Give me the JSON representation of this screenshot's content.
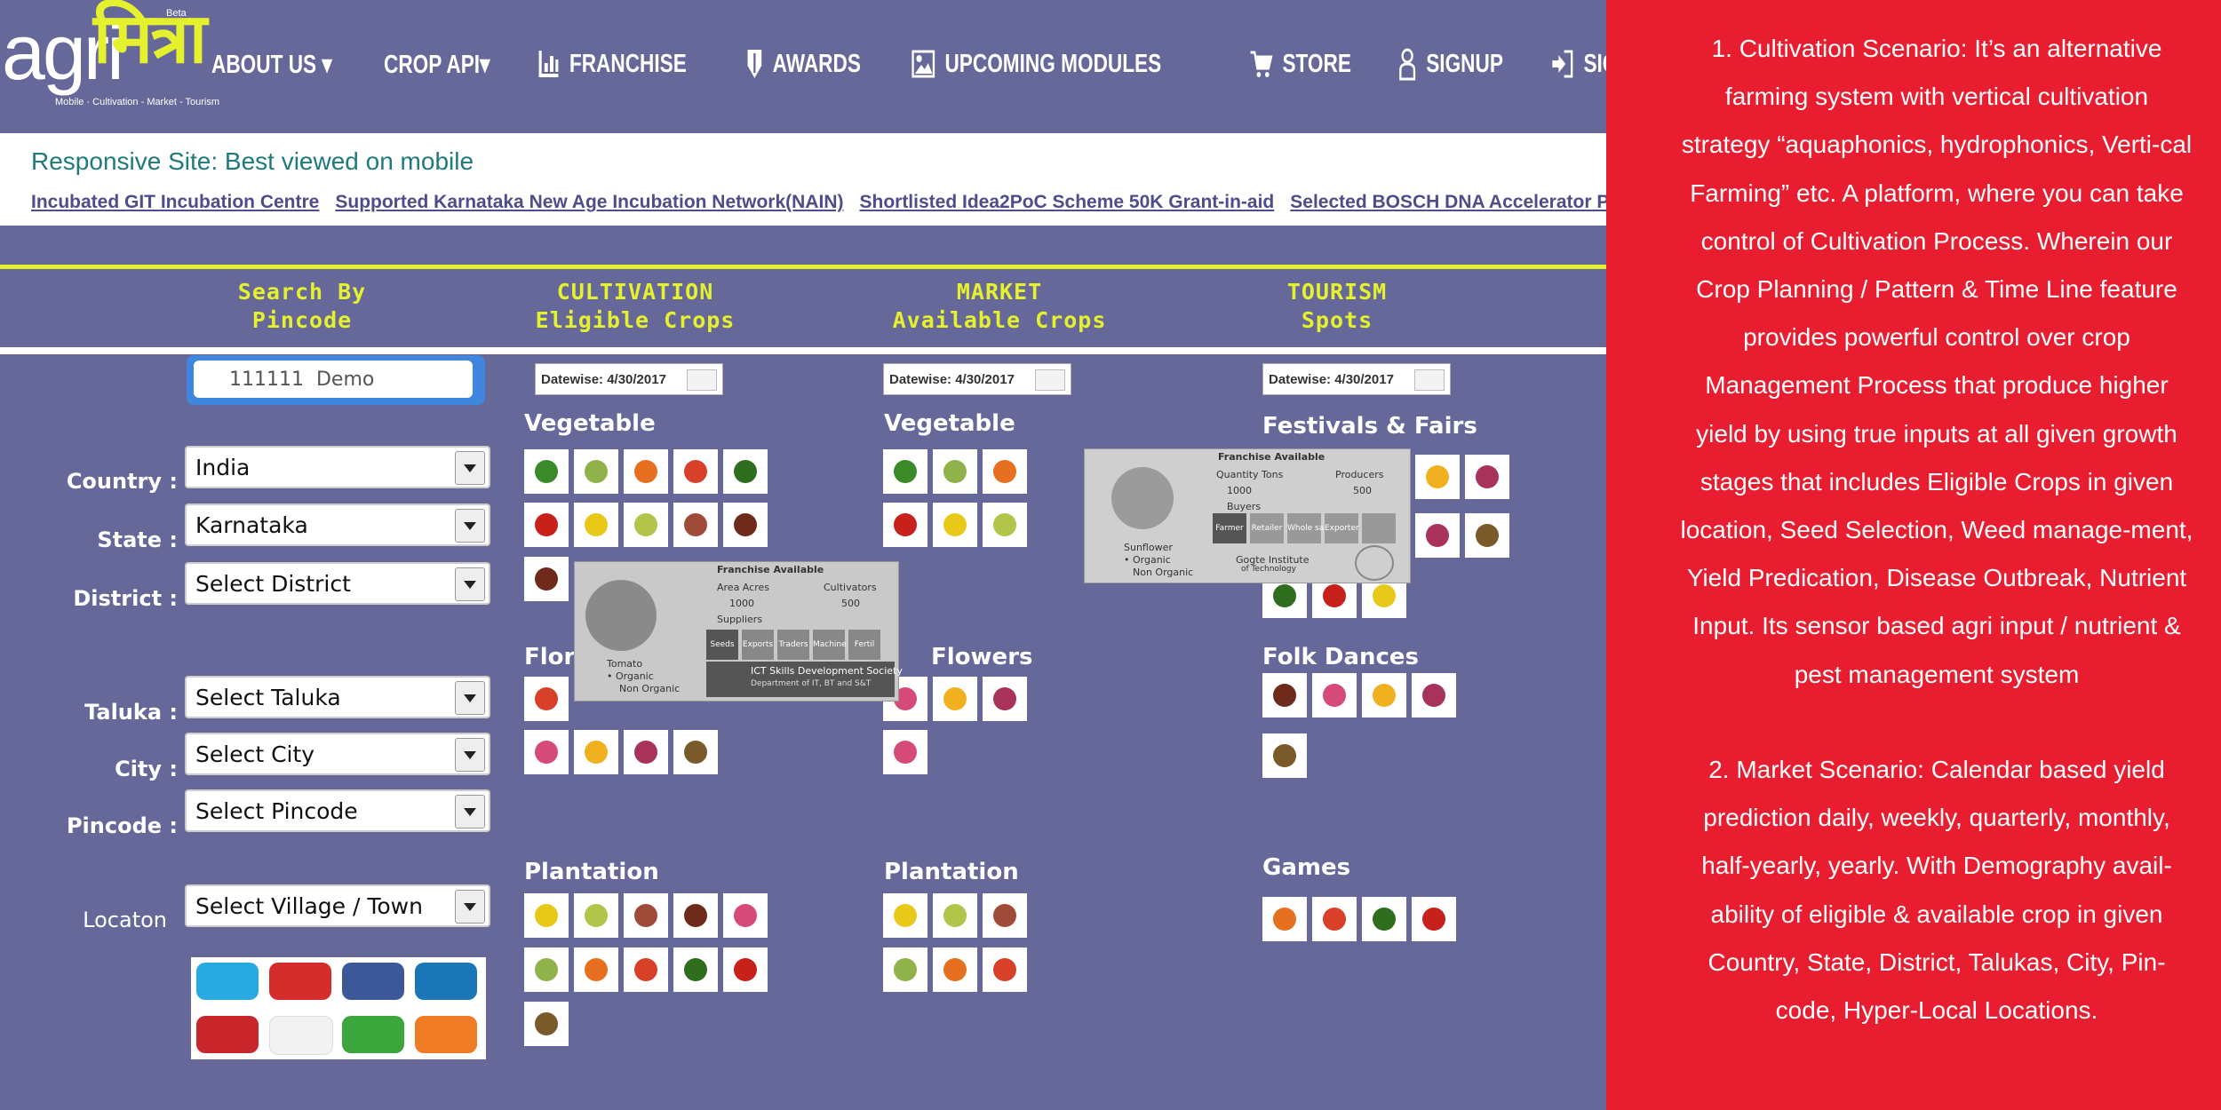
{
  "logo": {
    "agri": "agri",
    "mitra": "मित्रा",
    "beta": "Beta",
    "tagline": "Mobile · Cultivation - Market - Tourism"
  },
  "nav": [
    {
      "label": "ABOUT US ▾",
      "icon": "none"
    },
    {
      "label": "CROP API▾",
      "icon": "none"
    },
    {
      "label": "FRANCHISE",
      "icon": "bar-chart-icon"
    },
    {
      "label": "AWARDS",
      "icon": "shield-icon"
    },
    {
      "label": "UPCOMING MODULES",
      "icon": "picture-icon"
    },
    {
      "label": "STORE",
      "icon": "cart-icon"
    },
    {
      "label": "SIGNUP",
      "icon": "user-icon"
    },
    {
      "label": "SIGNIN",
      "icon": "signin-icon"
    }
  ],
  "banner": {
    "title": "Responsive Site: Best viewed on mobile",
    "links": [
      "Incubated GIT Incubation Centre",
      "Supported Karnataka New Age Incubation Network(NAIN)",
      "Shortlisted Idea2PoC Scheme 50K Grant-in-aid",
      "Selected BOSCH DNA Accelerator Program"
    ]
  },
  "headers": {
    "search": [
      "Search By",
      "Pincode"
    ],
    "cultivation": [
      "CULTIVATION",
      "Eligible Crops"
    ],
    "market": [
      "MARKET",
      "Available Crops"
    ],
    "tourism": [
      "TOURISM",
      "Spots"
    ]
  },
  "form": {
    "pincode_value": "111111  Demo",
    "country_label": "Country :",
    "country_value": "India",
    "state_label": "State :",
    "state_value": "Karnataka",
    "district_label": "District :",
    "district_value": "Select District",
    "taluka_label": "Taluka :",
    "taluka_value": "Select Taluka",
    "city_label": "City :",
    "city_value": "Select City",
    "pincode_label": "Pincode :",
    "pincode_select": "Select Pincode",
    "location_label": "Locaton",
    "location_value": "Select  Village / Town"
  },
  "date": "Datewise:  4/30/2017",
  "cultivation": {
    "veg": "Vegetable",
    "flori": "Flori",
    "plantation": "Plantation"
  },
  "market": {
    "veg": "Vegetable",
    "flowers": "Flowers",
    "plantation": "Plantation"
  },
  "tourism": {
    "festivals": "Festivals & Fairs",
    "dances": "Folk Dances",
    "games": "Games"
  },
  "overlay1": {
    "title": "Franchise Available",
    "c1": "Area Acres",
    "c2": "Cultivators",
    "v1": "1000",
    "v2": "500",
    "sub": "Suppliers",
    "crop": "Tomato",
    "o1": "• Organic",
    "o2": "Non Organic",
    "b1": "Seeds",
    "b2": "Exports",
    "b3": "Traders",
    "b4": "Machine",
    "b5": "Fertil",
    "footer": "ICT Skills Development Society",
    "footer2": "Department of IT, BT and S&T"
  },
  "overlay2": {
    "title": "Franchise Available",
    "c1": "Quantity Tons",
    "c2": "Producers",
    "v1": "1000",
    "v2": "500",
    "sub": "Buyers",
    "crop": "Sunflower",
    "o1": "• Organic",
    "o2": "Non Organic",
    "b1": "Farmer",
    "b2": "Retailer",
    "b3": "Whole sale",
    "b4": "Exporter",
    "b5": "",
    "footer": "Gogte Institute",
    "footer2": "of Technology"
  },
  "right": {
    "p1": "1.    Cultivation Scenario: It’s an alternative farming system with vertical cultivation strategy “aquaphonics, hydrophonics, Verti-cal Farming” etc. A platform, where you can take control of Cultivation Process. Wherein our Crop Planning / Pattern  & Time Line feature  provides powerful control over crop Management Process that produce higher yield by using true inputs at all given growth stages that includes Eligible Crops in given location, Seed Selection, Weed manage-ment, Yield Predication, Disease Outbreak, Nutrient Input. Its sensor based agri input / nutrient & pest management system",
    "p2": "2.   Market Scenario:  Calendar based yield prediction daily, weekly, quarterly, monthly, half-yearly, yearly. With Demography avail-ability of eligible & available crop in given Country, State, District, Talukas, City, Pin-code, Hyper-Local Locations."
  }
}
